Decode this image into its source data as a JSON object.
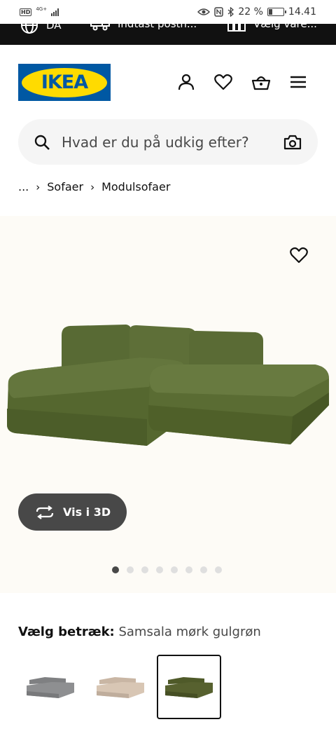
{
  "status_bar": {
    "hd": "HD",
    "network": "4G+",
    "battery_percent": "22 %",
    "time": "14.41"
  },
  "topbar": {
    "language": "DA",
    "postcode": "Indtast postn...",
    "store": "Vælg vare..."
  },
  "header": {
    "logo_text": "IKEA"
  },
  "search": {
    "placeholder": "Hvad er du på udkig efter?"
  },
  "breadcrumb": {
    "ellipsis": "...",
    "items": [
      "Sofaer",
      "Modulsofaer"
    ]
  },
  "gallery": {
    "button_3d_label": "Vis i 3D",
    "image_count": 8,
    "active_index": 0
  },
  "fabric": {
    "label": "Vælg betræk:",
    "selected_value": "Samsala mørk gulgrøn",
    "options": [
      {
        "name": "grey",
        "color": "#8e8f91"
      },
      {
        "name": "beige",
        "color": "#d8c6b4"
      },
      {
        "name": "dark-yellow-green",
        "color": "#57612f"
      }
    ],
    "selected_index": 2
  },
  "colors": {
    "ikea_blue": "#0058a3",
    "ikea_yellow": "#ffdb00",
    "sofa_green": "#5a6b37"
  }
}
